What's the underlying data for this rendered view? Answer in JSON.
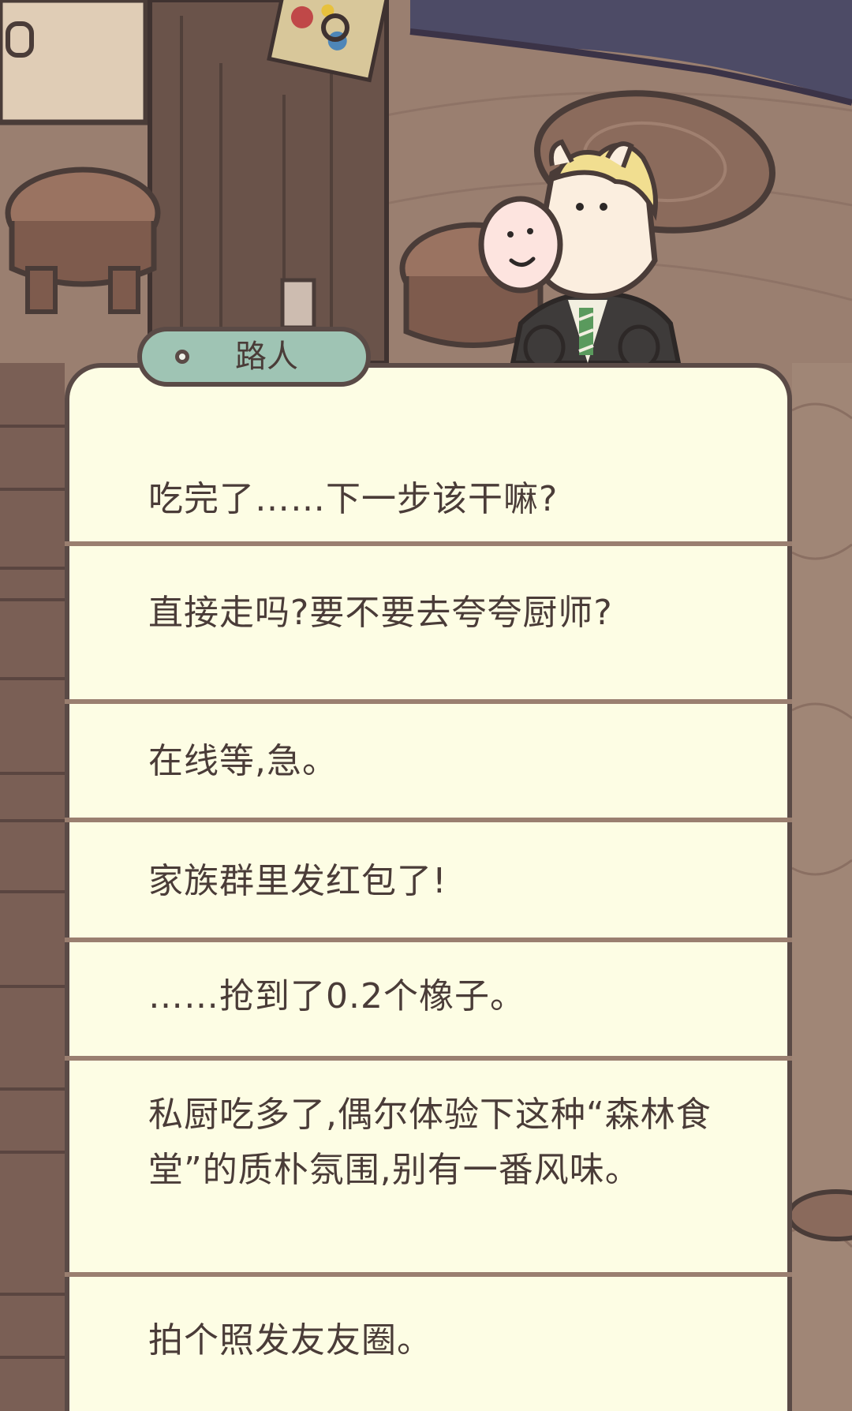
{
  "speaker": {
    "name": "路人"
  },
  "dialog_lines": [
    "吃完了……下一步该干嘛?",
    "直接走吗?要不要去夸夸厨师?",
    "在线等,急。",
    "家族群里发红包了!",
    "……抢到了0.2个橡子。",
    "私厨吃多了,偶尔体验下这种“森林食堂”的质朴氛围,别有一番风味。",
    "拍个照发友友圈。"
  ],
  "colors": {
    "panel": "#fdfde4",
    "outline": "#5a4a46",
    "tag": "#9fc4b4",
    "wood_dark": "#7a5f55",
    "wood_light": "#a08676"
  }
}
